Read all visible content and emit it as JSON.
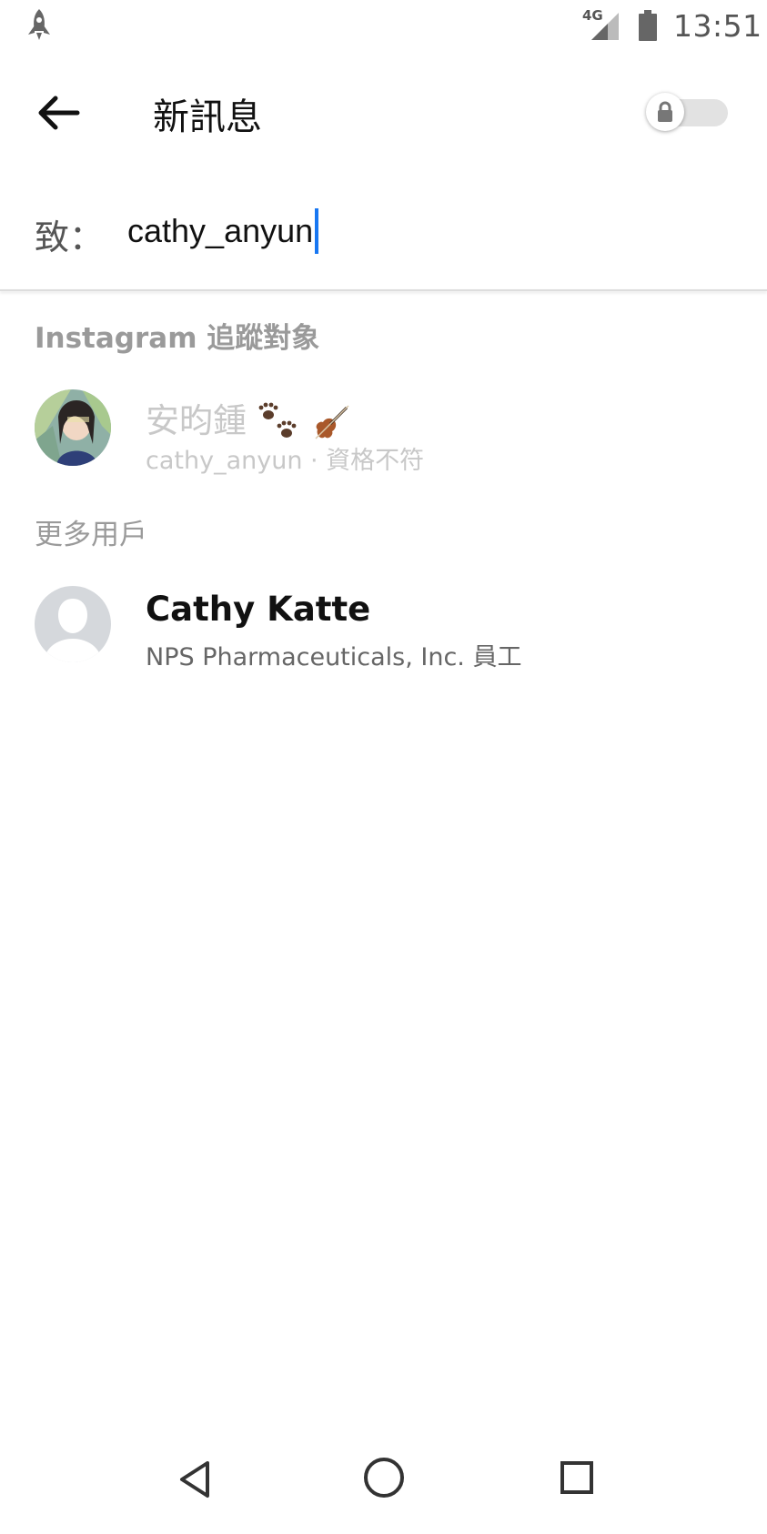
{
  "status_bar": {
    "network_type": "4G",
    "time": "13:51"
  },
  "header": {
    "title": "新訊息",
    "lock_toggle_state": "off"
  },
  "recipient": {
    "label": "致：",
    "value": "cathy_anyun"
  },
  "sections": {
    "instagram_following": "Instagram 追蹤對象",
    "more_users": "更多用戶"
  },
  "contacts": {
    "instagram": {
      "name": "安昀鍾",
      "subtitle": "cathy_anyun · 資格不符",
      "name_emoji_icons": [
        "paw-prints-icon",
        "violin-icon"
      ]
    },
    "more": {
      "name": "Cathy Katte",
      "subtitle": "NPS Pharmaceuticals, Inc. 員工"
    }
  },
  "colors": {
    "caret": "#1877f2",
    "disabled_text": "#c8c8c8",
    "section_header": "#9a9a9a"
  }
}
